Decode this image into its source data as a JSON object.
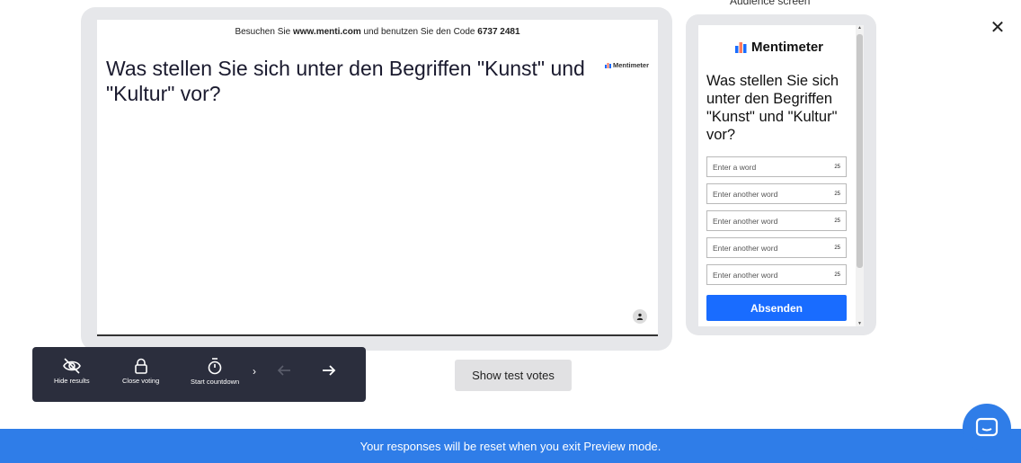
{
  "slide": {
    "join_prefix": "Besuchen Sie ",
    "join_url": "www.menti.com",
    "join_middle": " und benutzen Sie den Code ",
    "join_code": "6737 2481",
    "title": "Was stellen Sie sich unter den Begriffen \"Kunst\" und \"Kultur\" vor?",
    "brand": "Mentimeter"
  },
  "audience": {
    "label": "Audience screen",
    "brand": "Mentimeter",
    "question": "Was stellen Sie sich unter den Begriffen \"Kunst\" und \"Kultur\" vor?",
    "inputs": [
      {
        "placeholder": "Enter a word",
        "count": "25"
      },
      {
        "placeholder": "Enter another word",
        "count": "25"
      },
      {
        "placeholder": "Enter another word",
        "count": "25"
      },
      {
        "placeholder": "Enter another word",
        "count": "25"
      },
      {
        "placeholder": "Enter another word",
        "count": "25"
      }
    ],
    "submit": "Absenden"
  },
  "toolbar": {
    "hide_results": "Hide results",
    "close_voting": "Close voting",
    "start_countdown": "Start countdown"
  },
  "test_votes_button": "Show test votes",
  "banner": "Your responses will be reset when you exit Preview mode.",
  "colors": {
    "accent": "#196cff",
    "banner": "#2f7de8",
    "toolbar": "#2b2e3d"
  }
}
